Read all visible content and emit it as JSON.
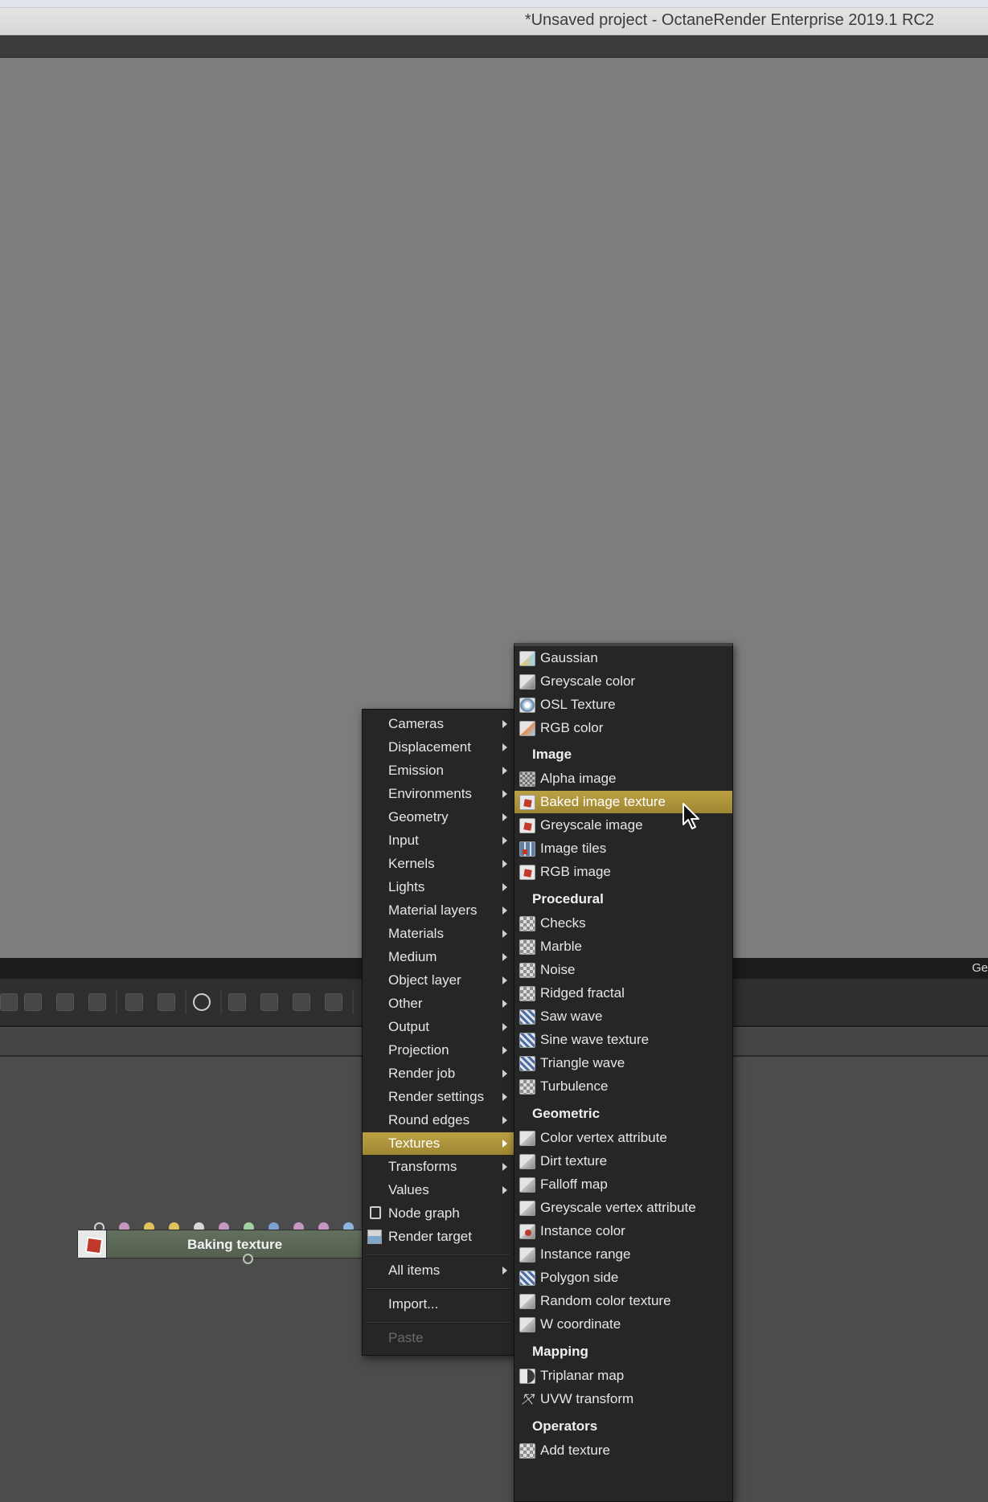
{
  "window": {
    "title": "*Unsaved project - OctaneRender Enterprise 2019.1 RC2"
  },
  "statusbar": {
    "right_text": "Ge"
  },
  "node": {
    "label": "Baking texture",
    "icon": "image-texture-icon"
  },
  "main_menu": {
    "items": [
      {
        "label": "Cameras",
        "submenu": true
      },
      {
        "label": "Displacement",
        "submenu": true
      },
      {
        "label": "Emission",
        "submenu": true
      },
      {
        "label": "Environments",
        "submenu": true
      },
      {
        "label": "Geometry",
        "submenu": true
      },
      {
        "label": "Input",
        "submenu": true
      },
      {
        "label": "Kernels",
        "submenu": true
      },
      {
        "label": "Lights",
        "submenu": true
      },
      {
        "label": "Material layers",
        "submenu": true
      },
      {
        "label": "Materials",
        "submenu": true
      },
      {
        "label": "Medium",
        "submenu": true
      },
      {
        "label": "Object layer",
        "submenu": true
      },
      {
        "label": "Other",
        "submenu": true
      },
      {
        "label": "Output",
        "submenu": true
      },
      {
        "label": "Projection",
        "submenu": true
      },
      {
        "label": "Render job",
        "submenu": true
      },
      {
        "label": "Render settings",
        "submenu": true
      },
      {
        "label": "Round edges",
        "submenu": true
      },
      {
        "label": "Textures",
        "submenu": true,
        "selected": true
      },
      {
        "label": "Transforms",
        "submenu": true
      },
      {
        "label": "Values",
        "submenu": true
      },
      {
        "label": "Node graph",
        "icon": "node-graph-icon"
      },
      {
        "label": "Render target",
        "icon": "render-target-icon"
      }
    ],
    "all_items": "All items",
    "import": "Import...",
    "paste": "Paste"
  },
  "textures_menu": {
    "top_items": [
      "Gaussian",
      "Greyscale color",
      "OSL Texture",
      "RGB color"
    ],
    "sections": [
      {
        "header": "Image",
        "items": [
          "Alpha image",
          "Baked image texture",
          "Greyscale image",
          "Image tiles",
          "RGB image"
        ],
        "selected": "Baked image texture"
      },
      {
        "header": "Procedural",
        "items": [
          "Checks",
          "Marble",
          "Noise",
          "Ridged fractal",
          "Saw wave",
          "Sine wave texture",
          "Triangle wave",
          "Turbulence"
        ]
      },
      {
        "header": "Geometric",
        "items": [
          "Color vertex attribute",
          "Dirt texture",
          "Falloff map",
          "Greyscale vertex attribute",
          "Instance color",
          "Instance range",
          "Polygon side",
          "Random color texture",
          "W coordinate"
        ]
      },
      {
        "header": "Mapping",
        "items": [
          "Triplanar map",
          "UVW transform"
        ]
      },
      {
        "header": "Operators",
        "items": [
          "Add texture"
        ]
      }
    ]
  },
  "colors": {
    "menu_highlight": "#bca143",
    "menu_bg": "#262626",
    "viewport_bg": "#7d7d7d",
    "node_green": "#5c6a58"
  }
}
